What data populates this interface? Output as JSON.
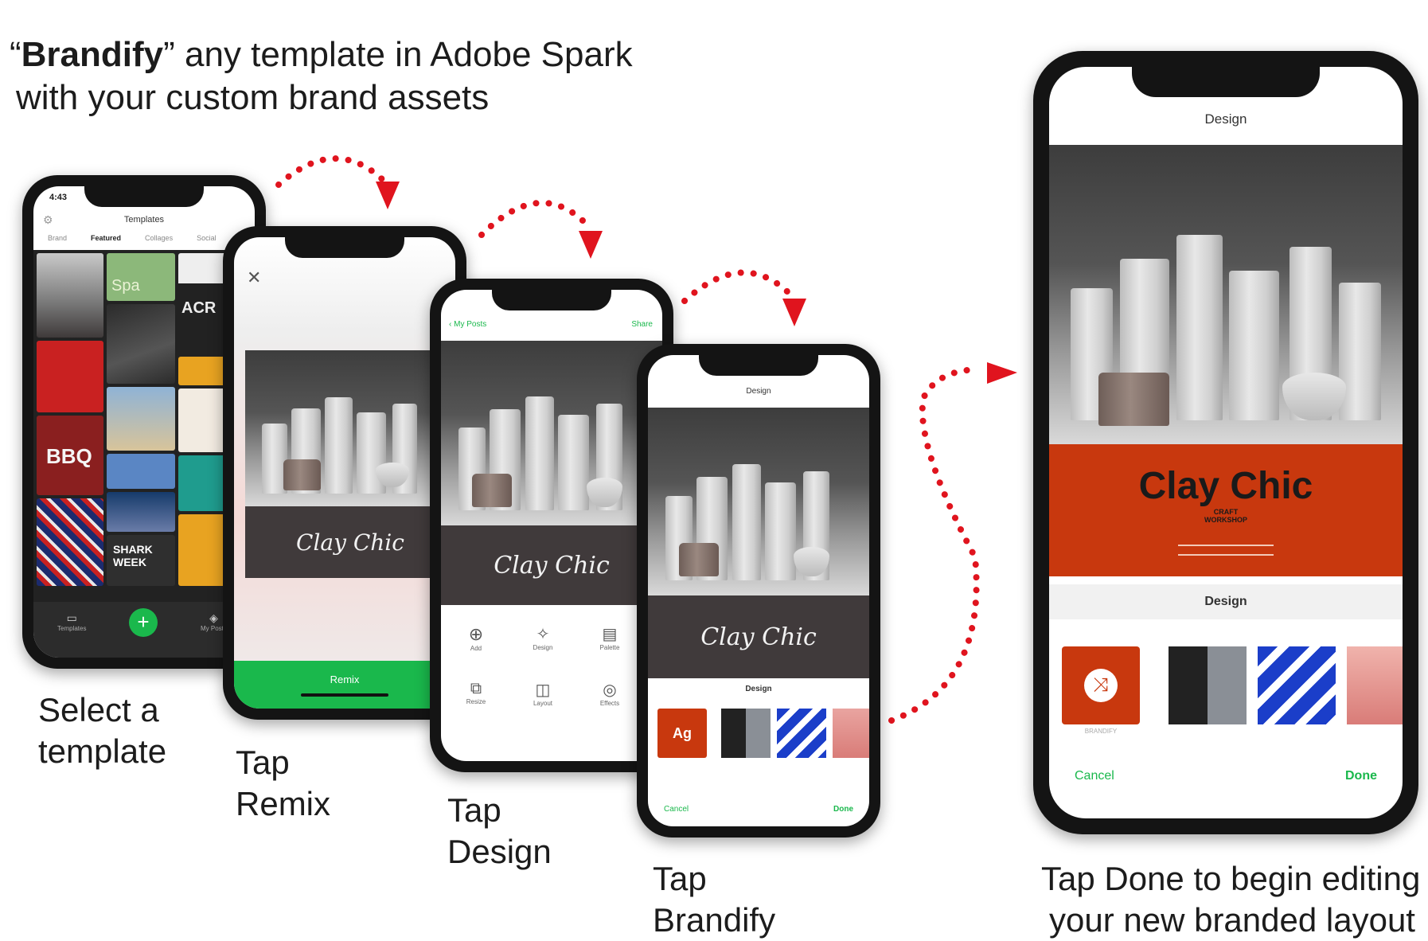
{
  "headline": {
    "line1_bold": "Brandify",
    "line1_rest": "” any template in Adobe Spark",
    "line1_open_quote": "“",
    "line2": "with your custom brand assets"
  },
  "steps": [
    {
      "caption_line1": "Select a",
      "caption_line2": "template"
    },
    {
      "caption_line1": "Tap",
      "caption_line2": "Remix"
    },
    {
      "caption_line1": "Tap",
      "caption_line2": "Design"
    },
    {
      "caption_line1": "Tap",
      "caption_line2": "Brandify"
    }
  ],
  "final_caption": {
    "line1": "Tap Done to begin editing",
    "line2": "your new branded layout"
  },
  "phone1": {
    "time": "4:43",
    "title": "Templates",
    "tabs": [
      "Brand",
      "Featured",
      "Collages",
      "Social"
    ],
    "tile_texts": [
      "Spa",
      "BBQ",
      "SHARK WEEK",
      "ACR"
    ],
    "bottom_left": "Templates",
    "bottom_right": "My Posts",
    "add_symbol": "+"
  },
  "phone2": {
    "close_symbol": "✕",
    "remix_label": "Remix",
    "brand_text": "Clay Chic"
  },
  "phone3": {
    "back_label": "My Posts",
    "share_label": "Share",
    "brand_text": "Clay Chic",
    "tools": [
      "Add",
      "Design",
      "Palette",
      "Resize",
      "Layout",
      "Effects"
    ]
  },
  "phone4": {
    "title": "Design",
    "brand_text": "Clay Chic",
    "section_label": "Design",
    "brandify_tile": "Ag",
    "cancel_label": "Cancel",
    "done_label": "Done"
  },
  "phone5": {
    "title": "Design",
    "brand_text": "Clay Chic",
    "brand_subtitle_1": "CRAFT",
    "brand_subtitle_2": "WORKSHOP",
    "section_label": "Design",
    "brandify_label": "BRANDIFY",
    "cancel_label": "Cancel",
    "done_label": "Done"
  },
  "colors": {
    "accent_green": "#1ab84c",
    "brand_orange": "#c8380e",
    "arrow_red": "#e0141e"
  }
}
